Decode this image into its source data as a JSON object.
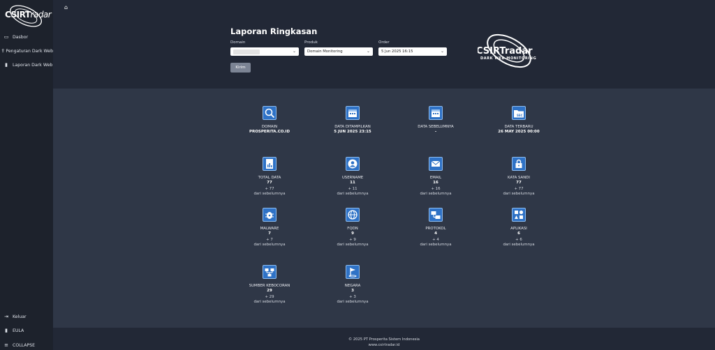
{
  "sidebar": {
    "logo": "CSIRTradar",
    "items": [
      {
        "label": "Dasbor",
        "icon": "monitor-icon"
      },
      {
        "label": "Pengaturan Dark Web",
        "icon": "upload-icon"
      },
      {
        "label": "Laporan Dark Web",
        "icon": "document-icon"
      }
    ],
    "bottom": [
      {
        "label": "Keluar",
        "icon": "logout-icon"
      },
      {
        "label": "EULA",
        "icon": "document-icon"
      },
      {
        "label": "COLLAPSE",
        "icon": "collapse-icon"
      }
    ]
  },
  "header": {
    "title": "Laporan Ringkasan",
    "domain_label": "Domain",
    "domain_value": "",
    "produk_label": "Produk",
    "produk_value": "Domain Monitoring",
    "order_label": "Order",
    "order_value": "5 Jun 2025 16:15",
    "submit_label": "Kirim",
    "logo_main": "CSIRTradar",
    "logo_tag": "DARK WEB MONITORING"
  },
  "cards": [
    {
      "label": "DOMAIN",
      "value": "PROSPERITA.CO.ID",
      "icon": "search-icon"
    },
    {
      "label": "DATA DITAMPILKAN",
      "value": "5 JUN 2025 23:15",
      "icon": "calendar-icon"
    },
    {
      "label": "DATA SEBELUMNYA",
      "value": "-",
      "icon": "calendar-icon"
    },
    {
      "label": "DATA TERBARU",
      "value": "26 MAY 2025 00:00",
      "icon": "folder-sec-icon"
    },
    {
      "label": "TOTAL DATA",
      "value": "77",
      "change": "+ 77",
      "sub": "dari sebelumnya",
      "icon": "document-chart-icon"
    },
    {
      "label": "USERNAME",
      "value": "11",
      "change": "+ 11",
      "sub": "dari sebelumnya",
      "icon": "user-icon"
    },
    {
      "label": "EMAIL",
      "value": "16",
      "change": "+ 16",
      "sub": "dari sebelumnya",
      "icon": "email-icon"
    },
    {
      "label": "KATA SANDI",
      "value": "77",
      "change": "+ 77",
      "sub": "dari sebelumnya",
      "icon": "lock-icon"
    },
    {
      "label": "MALWARE",
      "value": "7",
      "change": "+ 7",
      "sub": "dari sebelumnya",
      "icon": "bug-icon"
    },
    {
      "label": "FQDN",
      "value": "9",
      "change": "+ 9",
      "sub": "dari sebelumnya",
      "icon": "globe-icon"
    },
    {
      "label": "PROTOKOL",
      "value": "4",
      "change": "+ 4",
      "sub": "dari sebelumnya",
      "icon": "protocol-icon"
    },
    {
      "label": "APLIKASI",
      "value": "6",
      "change": "+ 6",
      "sub": "dari sebelumnya",
      "icon": "apps-icon"
    },
    {
      "label": "SUMBER KEBOCORAN",
      "value": "29",
      "change": "+ 29",
      "sub": "dari sebelumnya",
      "icon": "network-icon"
    },
    {
      "label": "NEGARA",
      "value": "3",
      "change": "+ 3",
      "sub": "dari sebelumnya",
      "icon": "flag-icon"
    }
  ],
  "footer": {
    "copyright": "© 2025 PT Prosperita Sistem Indonesia",
    "url": "www.csirtradar.id"
  },
  "colors": {
    "sidebar": "#1d222c",
    "header": "#222836",
    "content": "#2f3747",
    "icon_fill": "#2f72c6"
  }
}
